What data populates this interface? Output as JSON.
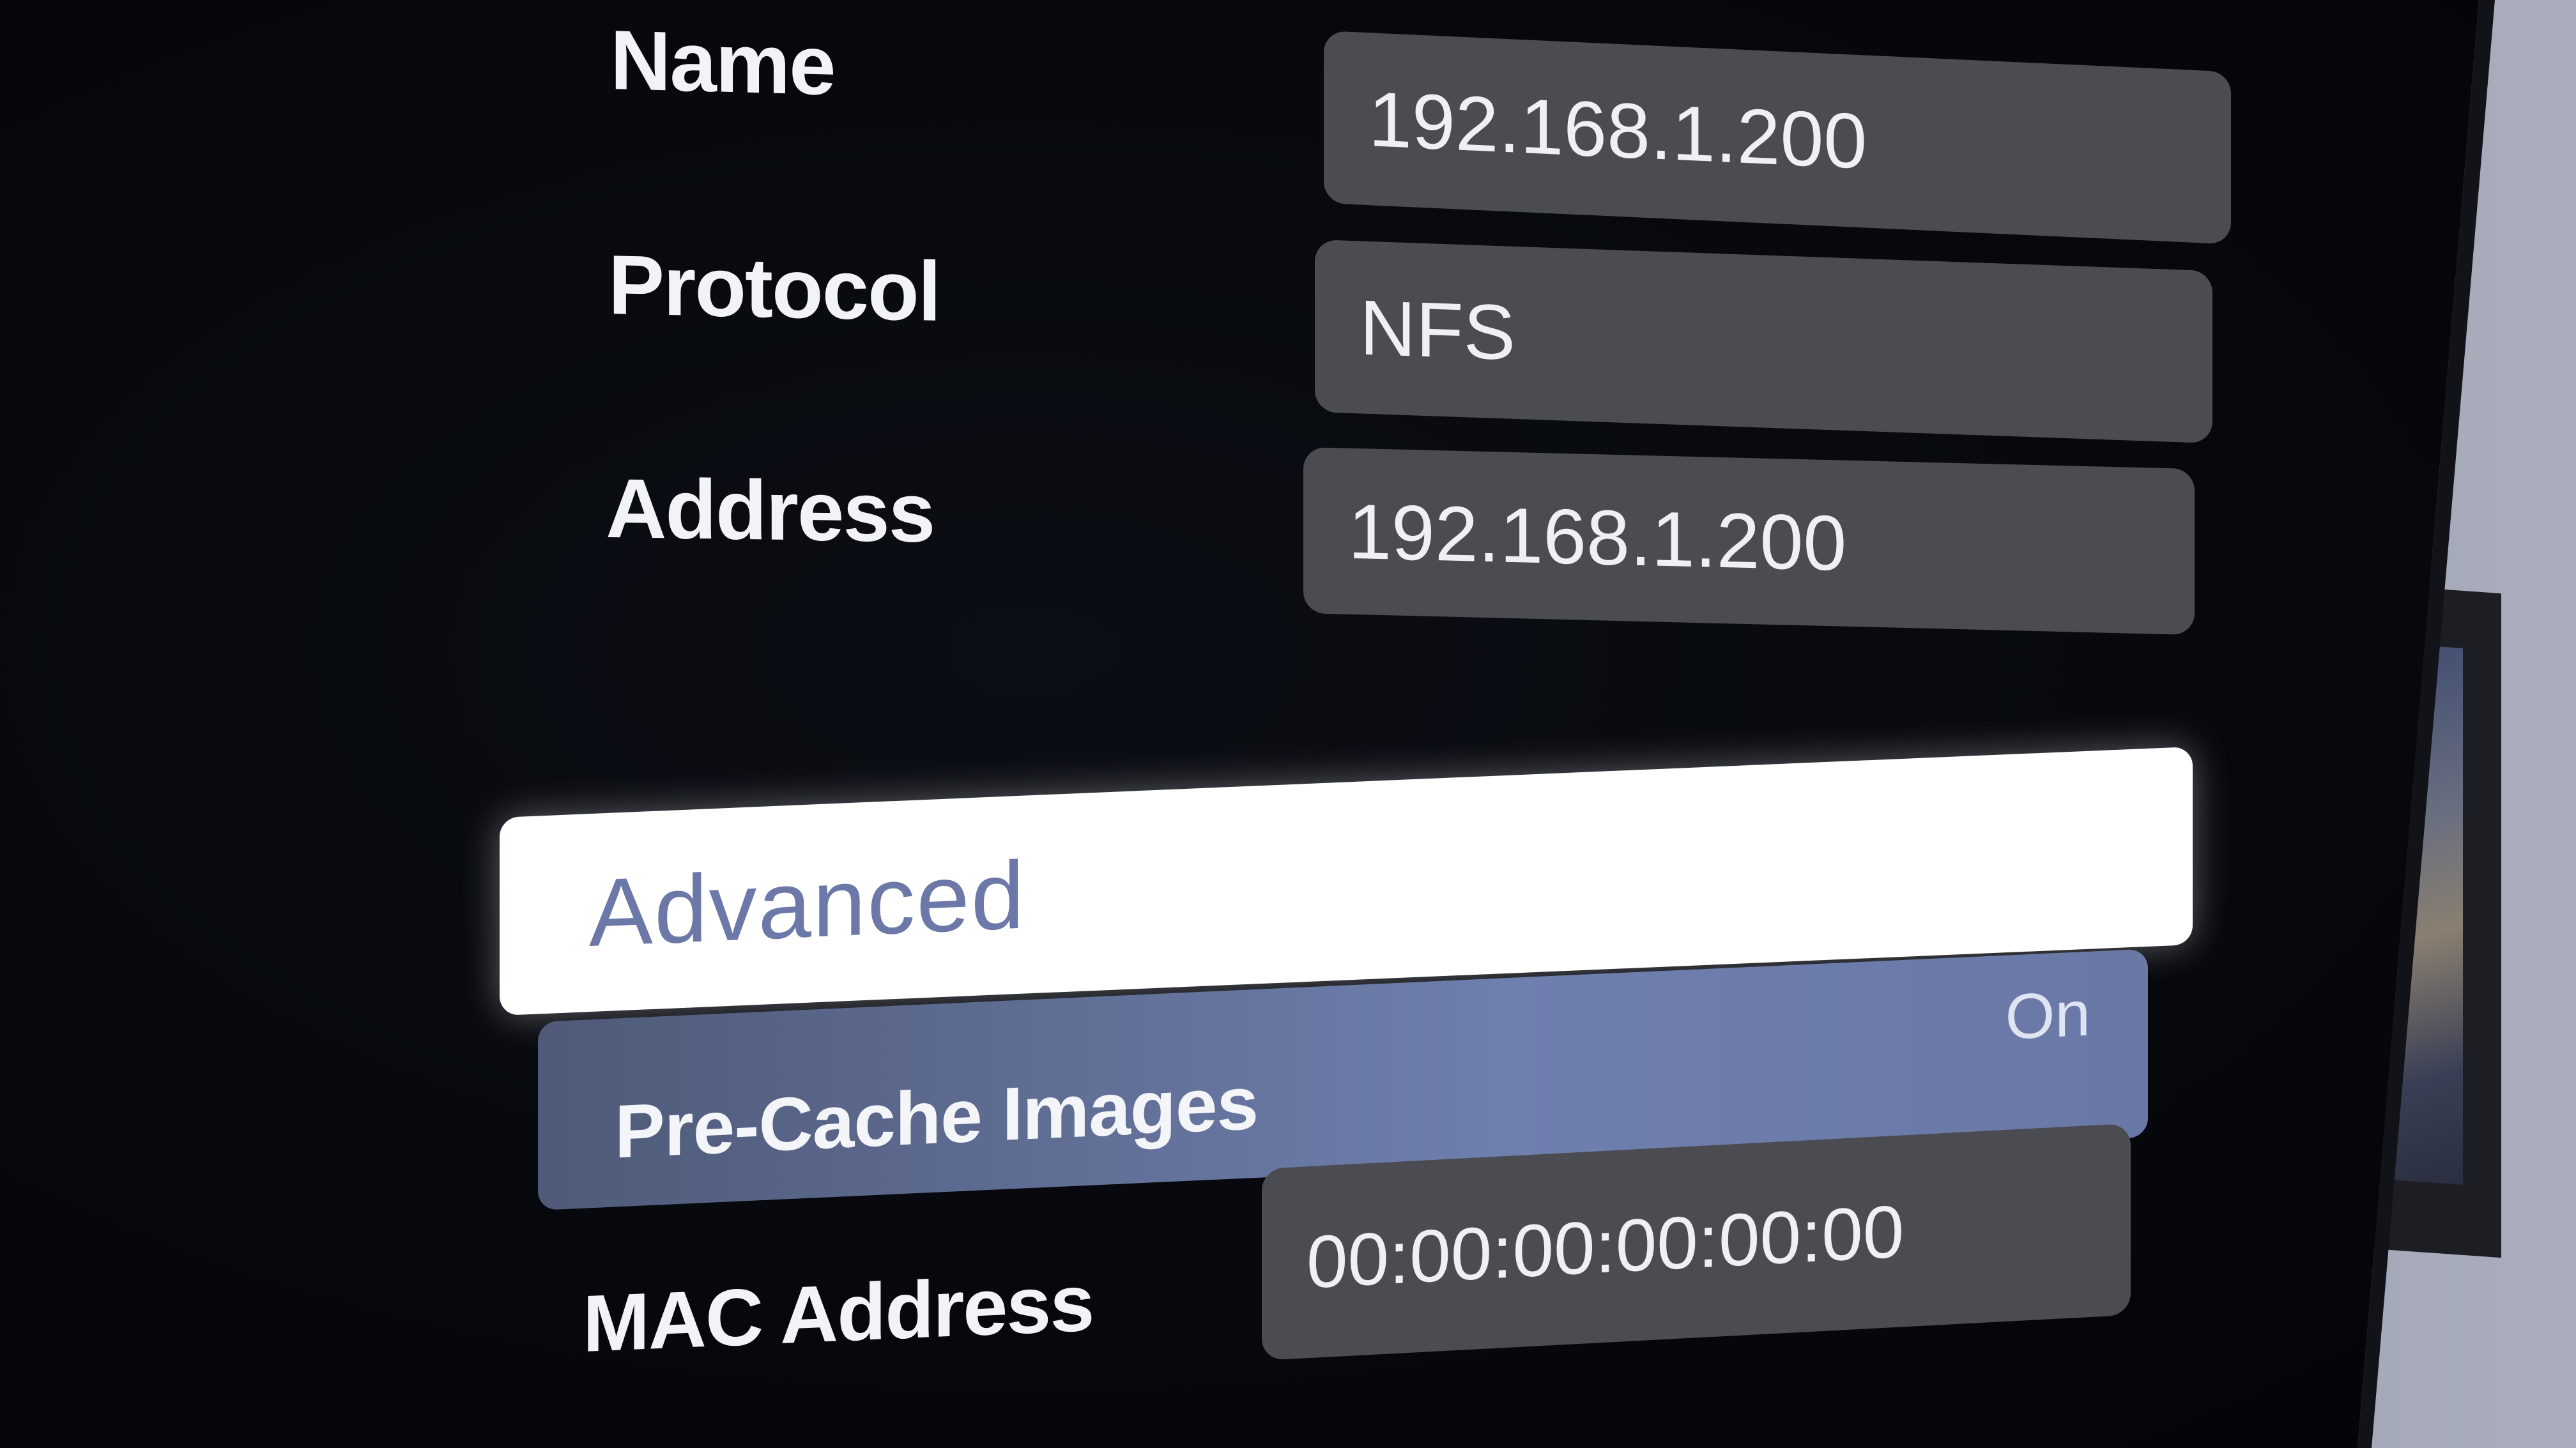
{
  "server_settings": {
    "name": {
      "label": "Name",
      "value": "192.168.1.200"
    },
    "protocol": {
      "label": "Protocol",
      "value": "NFS"
    },
    "address": {
      "label": "Address",
      "value": "192.168.1.200"
    },
    "advanced": {
      "label": "Advanced"
    },
    "pre_cache": {
      "label": "Pre-Cache Images",
      "value": "On"
    },
    "mac": {
      "label": "MAC Address",
      "value": "00:00:00:00:00:00"
    }
  },
  "colors": {
    "screen_background": "#05070b",
    "field_background": "#4a4c52",
    "focused_row": "#ffffff",
    "focused_text": "#6b78a8",
    "toggle_row": "#6f7fae"
  }
}
